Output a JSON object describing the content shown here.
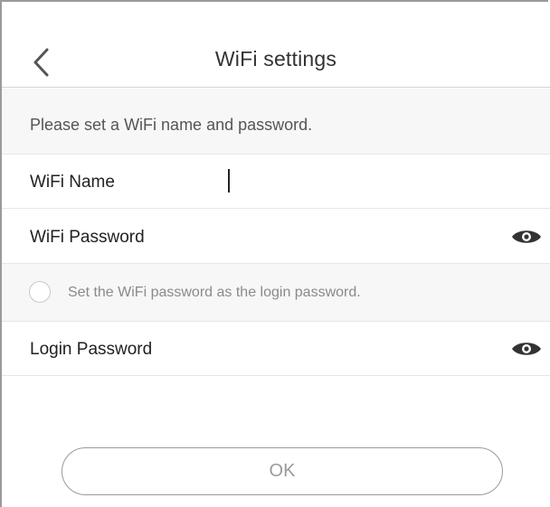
{
  "header": {
    "title": "WiFi settings",
    "back_icon": "chevron-left-icon"
  },
  "hint": {
    "text": "Please set a WiFi name and password."
  },
  "fields": {
    "wifi_name": {
      "label": "WiFi Name",
      "value": ""
    },
    "wifi_password": {
      "label": "WiFi Password",
      "value": "",
      "toggle_icon": "eye-icon"
    },
    "login_password": {
      "label": "Login Password",
      "value": "",
      "toggle_icon": "eye-icon"
    }
  },
  "option": {
    "label": "Set the WiFi password as the login password.",
    "checked": false
  },
  "actions": {
    "ok_label": "OK"
  },
  "colors": {
    "text": "#222222",
    "muted": "#8a8a8a",
    "row_bg": "#f7f7f7",
    "border": "#e6e6e6",
    "button_border": "#9a9a9a"
  }
}
